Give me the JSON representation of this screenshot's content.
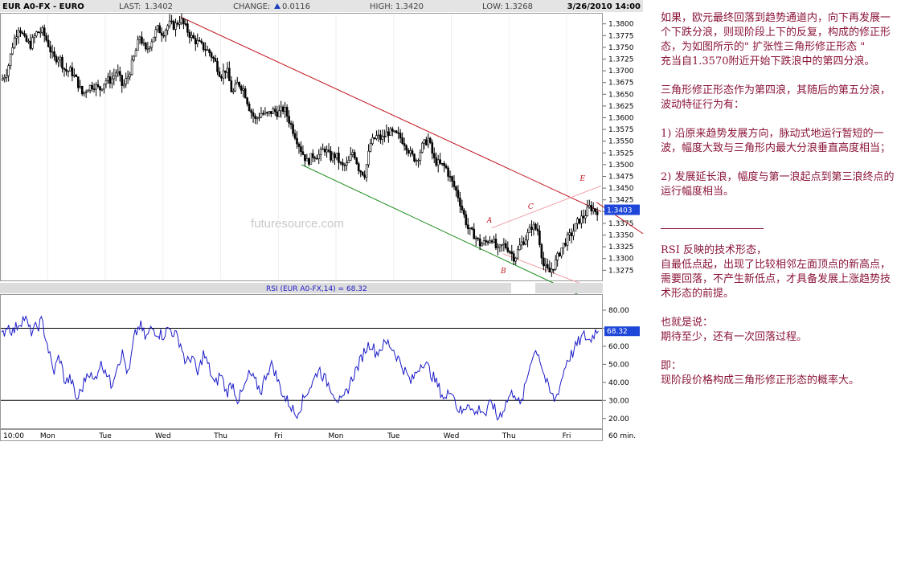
{
  "header": {
    "symbol": "EUR A0-FX - EURO",
    "last_label": "LAST:",
    "last_value": "1.3402",
    "change_label": "CHANGE:",
    "change_value": "0.0116",
    "high_label": "HIGH:",
    "high_value": "1.3420",
    "low_label": "LOW:",
    "low_value": "1.3268",
    "datetime": "3/26/2010 14:00"
  },
  "watermark": "futuresource.com",
  "current_price_label": "1.3403",
  "rsi_title": "RSI (EUR A0-FX,14) = 68.32",
  "rsi_current_label": "68.32",
  "wave_labels": [
    "A",
    "B",
    "C",
    "D",
    "E"
  ],
  "annotation": {
    "p1": "如果，欧元最终回落到趋势通道内，向下再发展一个下跌分浪，则现阶段上下的反复，构成的修正形态，为如图所示的\" 扩张性三角形修正形态 \"",
    "p2": "充当自1.3570附近开始下跌浪中的第四分浪。",
    "p3": "三角形修正形态作为第四浪，其随后的第五分浪，波动特征行为有：",
    "p4": "1) 沿原来趋势发展方向，脉动式地运行暂短的一波，幅度大致与三角形内最大分浪垂直高度相当；",
    "p5": "2) 发展延长浪，幅度与第一浪起点到第三浪终点的运行幅度相当。",
    "p6": "RSI 反映的技术形态，",
    "p7": "自最低点起，出现了比较相邻左面顶点的新高点，",
    "p8": "需要回落，不产生新低点，才具备发展上涨趋势技术形态的前提。",
    "p9": "也就是说：",
    "p10": "期待至少，还有一次回落过程。",
    "p11": "即：",
    "p12": "现阶段价格构成三角形修正形态的概率大。"
  },
  "colors": {
    "up_arrow": "#1f3fbf",
    "candles": "#000000",
    "rsi_line": "#1c1cc8",
    "resistance": "#c0141c",
    "support": "#1a8c1a",
    "triangle": "#f0a0a8",
    "annotation": "#8b1538",
    "price_box": "#1e46d8"
  },
  "chart_data": [
    {
      "type": "candlestick",
      "title": "EUR A0-FX - EURO",
      "interval": "60 min.",
      "ylim": [
        1.3255,
        1.382
      ],
      "y_ticks": [
        1.38,
        1.3775,
        1.375,
        1.3725,
        1.37,
        1.3675,
        1.365,
        1.3625,
        1.36,
        1.3575,
        1.355,
        1.3525,
        1.35,
        1.3475,
        1.345,
        1.3425,
        1.34,
        1.3375,
        1.335,
        1.3325,
        1.33,
        1.3275
      ],
      "y_tick_labels": [
        "1.3800",
        "1.3775",
        "1.3750",
        "1.3725",
        "1.3700",
        "1.3675",
        "1.3650",
        "1.3625",
        "1.3600",
        "1.3575",
        "1.3550",
        "1.3525",
        "1.3500",
        "1.3475",
        "1.3450",
        "1.3425",
        "1.3400",
        "1.3375",
        "1.3350",
        "1.3325",
        "1.3300",
        "1.3275"
      ],
      "x_ticks": [
        "10:00",
        "Mon",
        "Tue",
        "Wed",
        "Thu",
        "Fri",
        "Mon",
        "Tue",
        "Wed",
        "Thu",
        "Fri"
      ],
      "x_tick_units": [
        0,
        8,
        18,
        28,
        38,
        48,
        58,
        68,
        78,
        88,
        98
      ],
      "x_range_units": [
        0,
        104
      ],
      "path": [
        [
          0,
          1.368
        ],
        [
          1,
          1.37
        ],
        [
          2,
          1.376
        ],
        [
          3,
          1.3795
        ],
        [
          4,
          1.3765
        ],
        [
          5,
          1.3755
        ],
        [
          6,
          1.378
        ],
        [
          7,
          1.3785
        ],
        [
          8,
          1.376
        ],
        [
          9,
          1.3725
        ],
        [
          10,
          1.373
        ],
        [
          11,
          1.37
        ],
        [
          12,
          1.37
        ],
        [
          13,
          1.368
        ],
        [
          14,
          1.365
        ],
        [
          15,
          1.3665
        ],
        [
          16,
          1.367
        ],
        [
          17,
          1.366
        ],
        [
          18,
          1.368
        ],
        [
          19,
          1.368
        ],
        [
          20,
          1.37
        ],
        [
          21,
          1.3665
        ],
        [
          22,
          1.369
        ],
        [
          23,
          1.373
        ],
        [
          24,
          1.3775
        ],
        [
          25,
          1.374
        ],
        [
          26,
          1.3765
        ],
        [
          27,
          1.379
        ],
        [
          28,
          1.378
        ],
        [
          29,
          1.38
        ],
        [
          30,
          1.3795
        ],
        [
          31,
          1.381
        ],
        [
          32,
          1.379
        ],
        [
          33,
          1.377
        ],
        [
          34,
          1.376
        ],
        [
          35,
          1.375
        ],
        [
          36,
          1.374
        ],
        [
          37,
          1.372
        ],
        [
          38,
          1.369
        ],
        [
          39,
          1.3705
        ],
        [
          40,
          1.365
        ],
        [
          41,
          1.3675
        ],
        [
          42,
          1.366
        ],
        [
          43,
          1.362
        ],
        [
          44,
          1.3595
        ],
        [
          45,
          1.361
        ],
        [
          46,
          1.3605
        ],
        [
          47,
          1.3615
        ],
        [
          48,
          1.361
        ],
        [
          49,
          1.362
        ],
        [
          50,
          1.359
        ],
        [
          51,
          1.356
        ],
        [
          52,
          1.353
        ],
        [
          53,
          1.3505
        ],
        [
          54,
          1.352
        ],
        [
          55,
          1.352
        ],
        [
          56,
          1.3535
        ],
        [
          57,
          1.3515
        ],
        [
          58,
          1.352
        ],
        [
          59,
          1.3495
        ],
        [
          60,
          1.35
        ],
        [
          61,
          1.353
        ],
        [
          62,
          1.349
        ],
        [
          63,
          1.348
        ],
        [
          64,
          1.3545
        ],
        [
          65,
          1.356
        ],
        [
          66,
          1.3555
        ],
        [
          67,
          1.357
        ],
        [
          68,
          1.3565
        ],
        [
          69,
          1.356
        ],
        [
          70,
          1.3545
        ],
        [
          71,
          1.352
        ],
        [
          72,
          1.351
        ],
        [
          73,
          1.354
        ],
        [
          74,
          1.3555
        ],
        [
          75,
          1.351
        ],
        [
          76,
          1.35
        ],
        [
          77,
          1.3495
        ],
        [
          78,
          1.3465
        ],
        [
          79,
          1.344
        ],
        [
          80,
          1.34
        ],
        [
          81,
          1.336
        ],
        [
          82,
          1.335
        ],
        [
          83,
          1.333
        ],
        [
          84,
          1.3335
        ],
        [
          85,
          1.3345
        ],
        [
          86,
          1.3315
        ],
        [
          87,
          1.333
        ],
        [
          88,
          1.332
        ],
        [
          89,
          1.33
        ],
        [
          90,
          1.333
        ],
        [
          91,
          1.3345
        ],
        [
          92,
          1.337
        ],
        [
          93,
          1.336
        ],
        [
          94,
          1.3285
        ],
        [
          95,
          1.327
        ],
        [
          96,
          1.329
        ],
        [
          97,
          1.332
        ],
        [
          98,
          1.334
        ],
        [
          99,
          1.3355
        ],
        [
          100,
          1.338
        ],
        [
          101,
          1.339
        ],
        [
          102,
          1.341
        ],
        [
          103,
          1.3402
        ]
      ],
      "lines": [
        {
          "name": "resistance",
          "from": [
            31,
            1.3815
          ],
          "to": [
            104,
            1.34
          ]
        },
        {
          "name": "support",
          "from": [
            52,
            1.35
          ],
          "to": [
            104,
            1.32
          ]
        },
        {
          "name": "triangle-upper",
          "from": [
            85,
            1.3365
          ],
          "to": [
            104,
            1.3455
          ]
        },
        {
          "name": "triangle-lower",
          "from": [
            87,
            1.331
          ],
          "to": [
            104,
            1.323
          ]
        }
      ],
      "wave_points": [
        {
          "label": "A",
          "x": 85,
          "y": 1.337
        },
        {
          "label": "B",
          "x": 87,
          "y": 1.3293
        },
        {
          "label": "C",
          "x": 92,
          "y": 1.3395
        },
        {
          "label": "D",
          "x": 93.5,
          "y": 1.3265
        },
        {
          "label": "E",
          "x": 101,
          "y": 1.3455
        }
      ],
      "last_price": 1.3403
    },
    {
      "type": "line",
      "title": "RSI (EUR A0-FX,14) = 68.32",
      "ylim": [
        15,
        88
      ],
      "y_ticks": [
        20,
        30,
        40,
        50,
        60,
        70,
        80
      ],
      "y_tick_labels": [
        "20.00",
        "30.00",
        "40.00",
        "50.00",
        "60.00",
        "",
        "80.00"
      ],
      "reference_lines": [
        70,
        30
      ],
      "x_range_units": [
        0,
        104
      ],
      "path": [
        [
          0,
          65
        ],
        [
          1,
          72
        ],
        [
          2,
          68
        ],
        [
          3,
          73
        ],
        [
          4,
          76
        ],
        [
          5,
          68
        ],
        [
          6,
          70
        ],
        [
          7,
          74
        ],
        [
          8,
          60
        ],
        [
          9,
          45
        ],
        [
          10,
          55
        ],
        [
          11,
          40
        ],
        [
          12,
          42
        ],
        [
          13,
          30
        ],
        [
          14,
          37
        ],
        [
          15,
          47
        ],
        [
          16,
          40
        ],
        [
          17,
          50
        ],
        [
          18,
          48
        ],
        [
          19,
          38
        ],
        [
          20,
          50
        ],
        [
          21,
          56
        ],
        [
          22,
          43
        ],
        [
          23,
          65
        ],
        [
          24,
          72
        ],
        [
          25,
          64
        ],
        [
          26,
          70
        ],
        [
          27,
          68
        ],
        [
          28,
          66
        ],
        [
          29,
          70
        ],
        [
          30,
          67
        ],
        [
          31,
          62
        ],
        [
          32,
          50
        ],
        [
          33,
          55
        ],
        [
          34,
          44
        ],
        [
          35,
          56
        ],
        [
          36,
          48
        ],
        [
          37,
          38
        ],
        [
          38,
          45
        ],
        [
          39,
          34
        ],
        [
          40,
          40
        ],
        [
          41,
          30
        ],
        [
          42,
          36
        ],
        [
          43,
          45
        ],
        [
          44,
          40
        ],
        [
          45,
          35
        ],
        [
          46,
          46
        ],
        [
          47,
          50
        ],
        [
          48,
          40
        ],
        [
          49,
          32
        ],
        [
          50,
          28
        ],
        [
          51,
          22
        ],
        [
          52,
          28
        ],
        [
          53,
          35
        ],
        [
          54,
          40
        ],
        [
          55,
          48
        ],
        [
          56,
          42
        ],
        [
          57,
          38
        ],
        [
          58,
          32
        ],
        [
          59,
          28
        ],
        [
          60,
          36
        ],
        [
          61,
          44
        ],
        [
          62,
          50
        ],
        [
          63,
          58
        ],
        [
          64,
          62
        ],
        [
          65,
          56
        ],
        [
          66,
          60
        ],
        [
          67,
          62
        ],
        [
          68,
          58
        ],
        [
          69,
          52
        ],
        [
          70,
          46
        ],
        [
          71,
          40
        ],
        [
          72,
          46
        ],
        [
          73,
          52
        ],
        [
          74,
          48
        ],
        [
          75,
          42
        ],
        [
          76,
          36
        ],
        [
          77,
          30
        ],
        [
          78,
          38
        ],
        [
          79,
          26
        ],
        [
          80,
          23
        ],
        [
          81,
          30
        ],
        [
          82,
          22
        ],
        [
          83,
          26
        ],
        [
          84,
          22
        ],
        [
          85,
          30
        ],
        [
          86,
          20
        ],
        [
          87,
          25
        ],
        [
          88,
          32
        ],
        [
          89,
          35
        ],
        [
          90,
          26
        ],
        [
          91,
          40
        ],
        [
          92,
          55
        ],
        [
          93,
          58
        ],
        [
          94,
          45
        ],
        [
          95,
          35
        ],
        [
          96,
          30
        ],
        [
          97,
          40
        ],
        [
          98,
          52
        ],
        [
          99,
          56
        ],
        [
          100,
          62
        ],
        [
          101,
          66
        ],
        [
          102,
          63
        ],
        [
          103,
          68.32
        ]
      ]
    }
  ]
}
